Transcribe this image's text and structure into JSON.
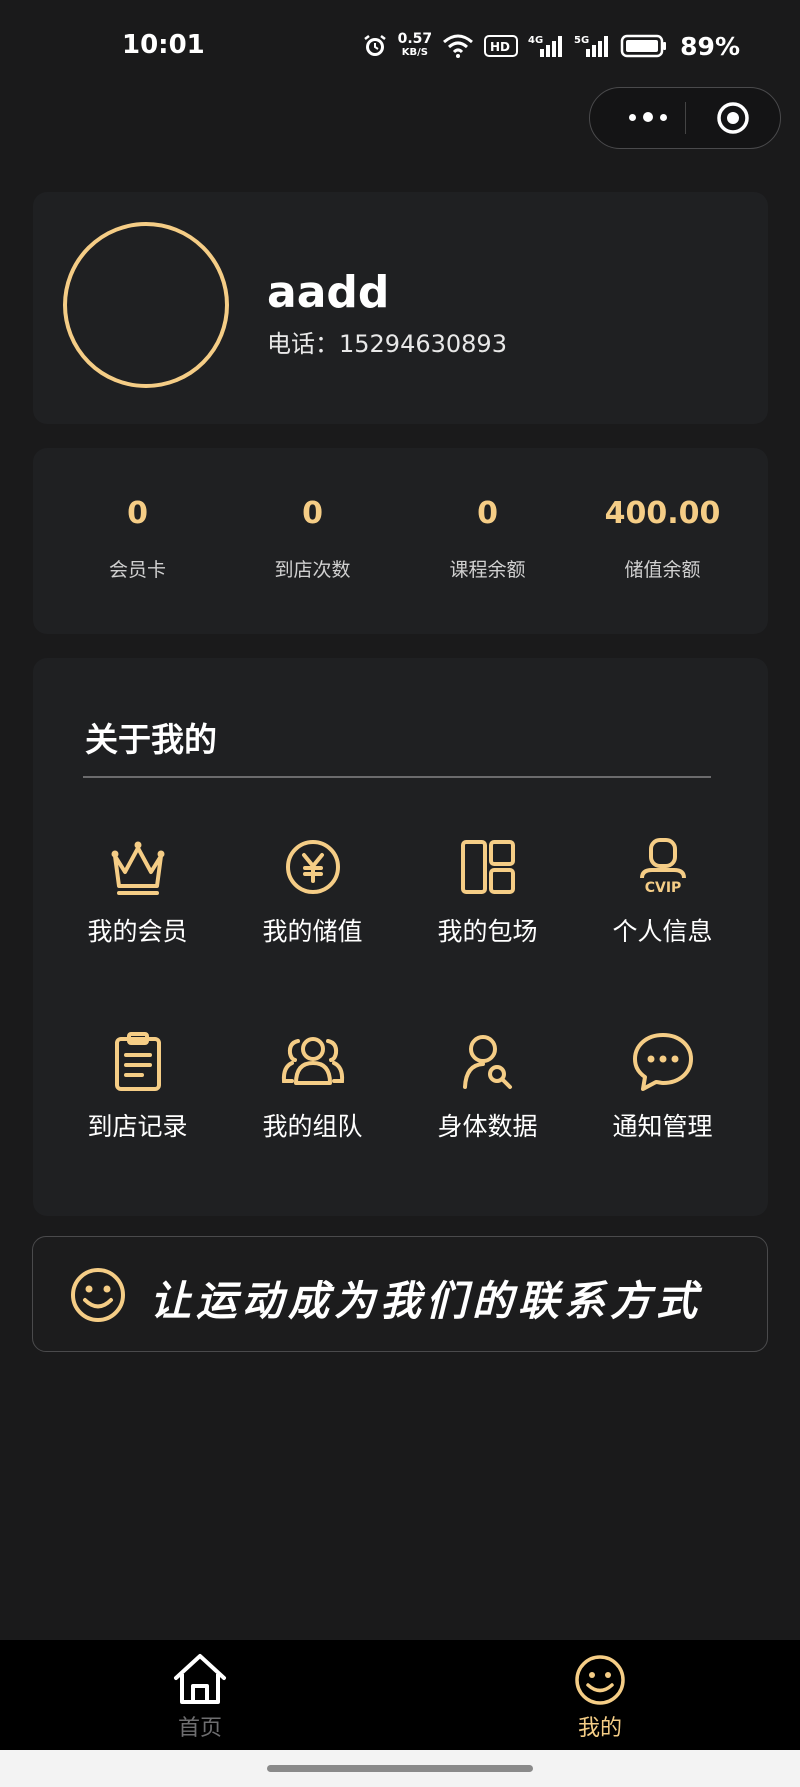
{
  "status_bar": {
    "time": "10:01",
    "net_speed_value": "0.57",
    "net_speed_unit": "KB/S",
    "hd_label": "HD",
    "signal1_label": "4G",
    "signal2_label": "5G",
    "battery_percent": "89%"
  },
  "profile": {
    "username": "aadd",
    "phone": "电话：15294630893"
  },
  "stats": [
    {
      "value": "0",
      "label": "会员卡"
    },
    {
      "value": "0",
      "label": "到店次数"
    },
    {
      "value": "0",
      "label": "课程余额"
    },
    {
      "value": "400.00",
      "label": "储值余额"
    }
  ],
  "about": {
    "title": "关于我的",
    "items": [
      {
        "label": "我的会员",
        "icon": "crown-icon"
      },
      {
        "label": "我的储值",
        "icon": "yen-coin-icon"
      },
      {
        "label": "我的包场",
        "icon": "layout-grid-icon"
      },
      {
        "label": "个人信息",
        "icon": "vip-user-icon"
      },
      {
        "label": "到店记录",
        "icon": "clipboard-icon"
      },
      {
        "label": "我的组队",
        "icon": "team-icon"
      },
      {
        "label": "身体数据",
        "icon": "user-search-icon"
      },
      {
        "label": "通知管理",
        "icon": "chat-bubble-icon"
      }
    ]
  },
  "slogan": {
    "text": "让运动成为我们的联系方式",
    "icon": "smile-icon"
  },
  "tabbar": {
    "home_label": "首页",
    "mine_label": "我的",
    "active": "mine"
  },
  "colors": {
    "accent": "#f5cd86",
    "background": "#1a1a1b",
    "card": "#1f2022",
    "tabbar": "#000000"
  }
}
